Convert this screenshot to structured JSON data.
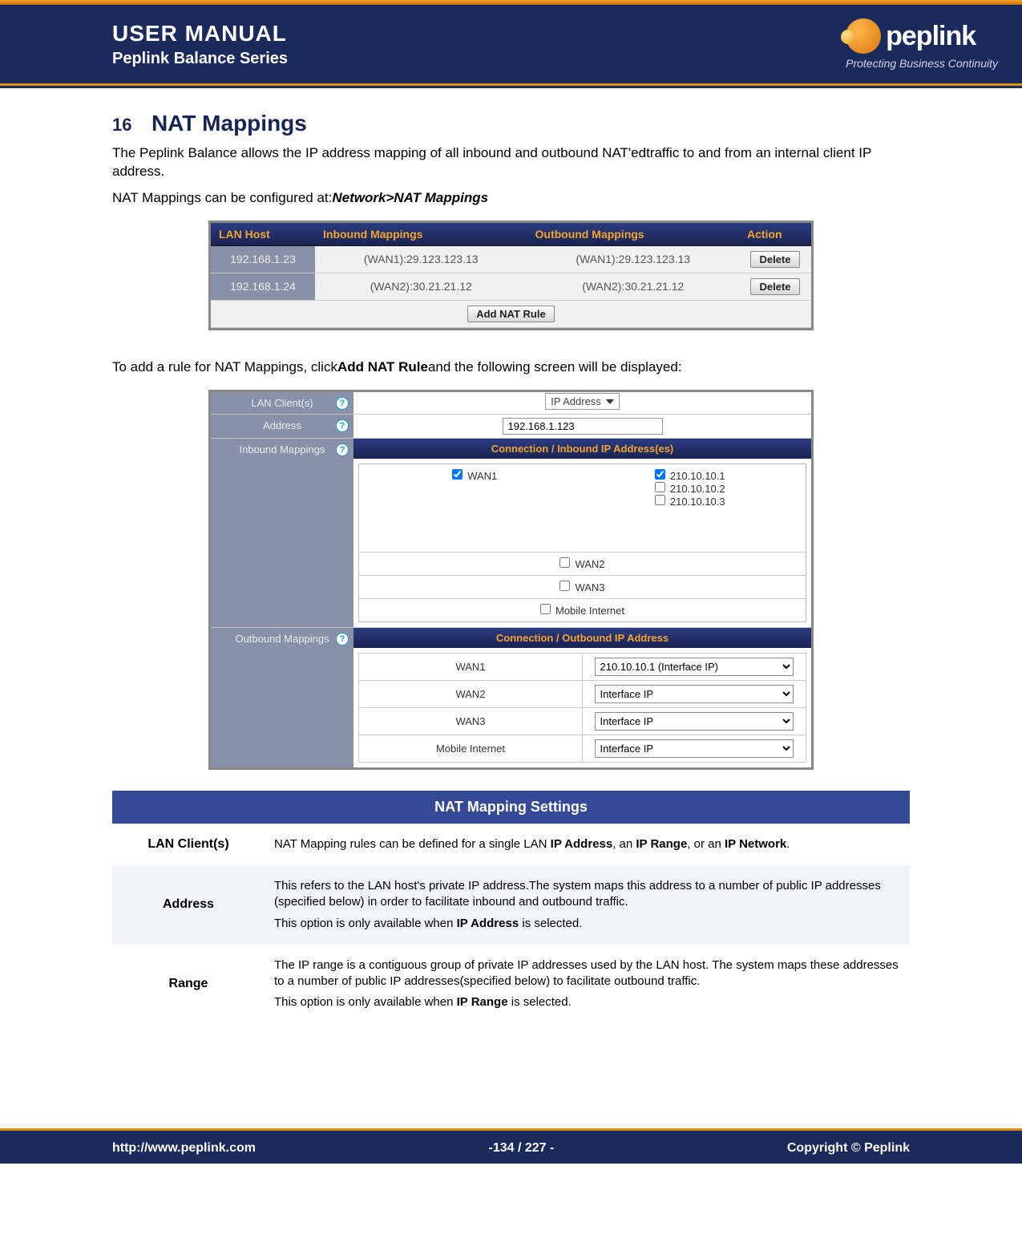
{
  "header": {
    "title": "USER MANUAL",
    "subtitle": "Peplink Balance Series",
    "brand": "peplink",
    "tagline": "Protecting Business Continuity"
  },
  "section": {
    "number": "16",
    "title": "NAT Mappings"
  },
  "intro": {
    "p1a": "The Peplink Balance allows the IP address mapping of all inbound and outbound NAT'ed",
    "p1b": "traffic to and from an internal client IP address.",
    "p2a": "NAT Mappings can be configured at:",
    "p2b": "Network>NAT Mappings"
  },
  "shot1": {
    "h_lan": "LAN Host",
    "h_in": "Inbound Mappings",
    "h_out": "Outbound Mappings",
    "h_act": "Action",
    "rows": [
      {
        "lan": "192.168.1.23",
        "in": "(WAN1):29.123.123.13",
        "out": "(WAN1):29.123.123.13"
      },
      {
        "lan": "192.168.1.24",
        "in": "(WAN2):30.21.21.12",
        "out": "(WAN2):30.21.21.12"
      }
    ],
    "delete": "Delete",
    "add": "Add NAT Rule"
  },
  "mid": {
    "p1a": "To add a rule for NAT Mappings, click",
    "p1b": "Add NAT Rule",
    "p1c": "and the following screen will be displayed:"
  },
  "shot2": {
    "lan_clients": "LAN Client(s)",
    "address_lbl": "Address",
    "inbound_lbl": "Inbound Mappings",
    "outbound_lbl": "Outbound Mappings",
    "sel_ipaddr": "IP Address",
    "address_val": "192.168.1.123",
    "sub_in": "Connection / Inbound IP Address(es)",
    "sub_out": "Connection / Outbound IP Address",
    "wan1": "WAN1",
    "wan2": "WAN2",
    "wan3": "WAN3",
    "mobile": "Mobile Internet",
    "ip1": "210.10.10.1",
    "ip2": "210.10.10.2",
    "ip3": "210.10.10.3",
    "out_wan1": "210.10.10.1 (Interface IP)",
    "out_iface": "Interface IP"
  },
  "settings": {
    "title": "NAT Mapping Settings",
    "rows": [
      {
        "k": "LAN Client(s)",
        "v_pre": "NAT Mapping rules can be defined for a single LAN ",
        "v_b1": "IP Address",
        "v_mid1": ", an ",
        "v_b2": "IP Range",
        "v_mid2": ", or an ",
        "v_b3": "IP Network",
        "v_post": "."
      },
      {
        "k": "Address",
        "l1": "This refers to the LAN host's private IP address.The system maps this address to a number of public IP addresses (specified below) in order to facilitate inbound and outbound traffic.",
        "l2a": "This option is only available when ",
        "l2b": "IP Address",
        "l2c": " is selected."
      },
      {
        "k": "Range",
        "l1": "The IP range is a contiguous group of private IP addresses used by the LAN host. The system maps these addresses to a number of public IP addresses(specified below) to facilitate outbound traffic.",
        "l2a": "This option is only available when ",
        "l2b": "IP Range",
        "l2c": " is selected."
      }
    ]
  },
  "footer": {
    "url": "http://www.peplink.com",
    "page": "-134 / 227 -",
    "copy": "Copyright ©  Peplink"
  }
}
